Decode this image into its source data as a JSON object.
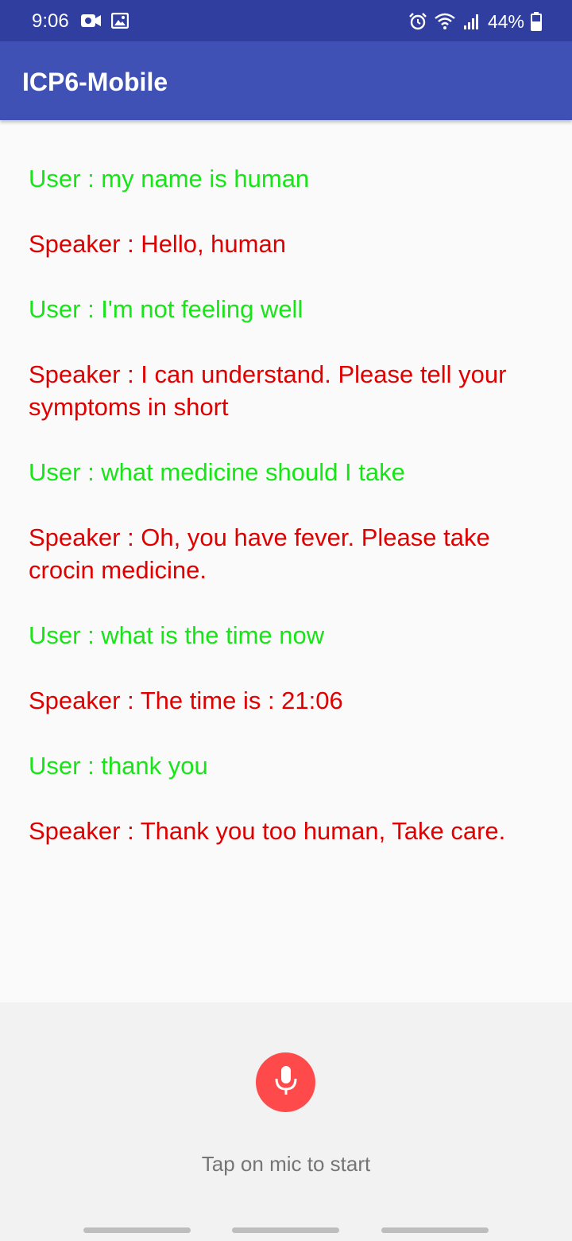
{
  "status_bar": {
    "time": "9:06",
    "battery": "44%",
    "left_icons": [
      "video-camera-icon",
      "image-icon"
    ],
    "right_icons": [
      "alarm-icon",
      "wifi-icon",
      "signal-icon",
      "battery-icon"
    ]
  },
  "app_bar": {
    "title": "ICP6-Mobile",
    "color": "#3f51b5"
  },
  "conversation": {
    "messages": [
      {
        "role": "user",
        "text": "User : my name is human"
      },
      {
        "role": "speaker",
        "text": "Speaker : Hello, human"
      },
      {
        "role": "user",
        "text": "User : I'm not feeling well"
      },
      {
        "role": "speaker",
        "text": "Speaker : I can understand. Please tell your symptoms in short"
      },
      {
        "role": "user",
        "text": "User : what medicine should I take"
      },
      {
        "role": "speaker",
        "text": "Speaker : Oh, you have fever. Please take crocin medicine."
      },
      {
        "role": "user",
        "text": "User : what is the time now"
      },
      {
        "role": "speaker",
        "text": "Speaker : The time is : 21:06"
      },
      {
        "role": "user",
        "text": "User : thank you"
      },
      {
        "role": "speaker",
        "text": "Speaker : Thank you too human, Take care."
      }
    ],
    "user_color": "#16e516",
    "speaker_color": "#e00000"
  },
  "mic": {
    "icon": "microphone-icon",
    "hint": "Tap on mic to start",
    "color": "#fe4a4a"
  }
}
